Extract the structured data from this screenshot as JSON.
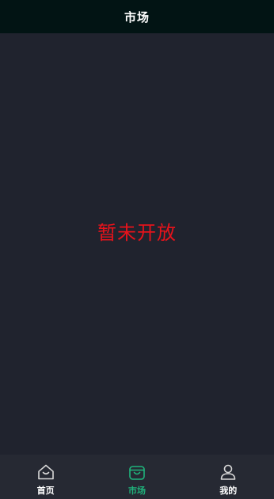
{
  "header": {
    "title": "市场"
  },
  "main": {
    "message": "暂未开放"
  },
  "tabbar": {
    "active": "market",
    "active_color": "#1fb47c",
    "inactive_color": "#d8d8d8",
    "tabs": [
      {
        "id": "home",
        "label": "首页",
        "icon": "home-icon"
      },
      {
        "id": "market",
        "label": "市场",
        "icon": "shopping-bag-icon"
      },
      {
        "id": "mine",
        "label": "我的",
        "icon": "user-icon"
      }
    ]
  }
}
